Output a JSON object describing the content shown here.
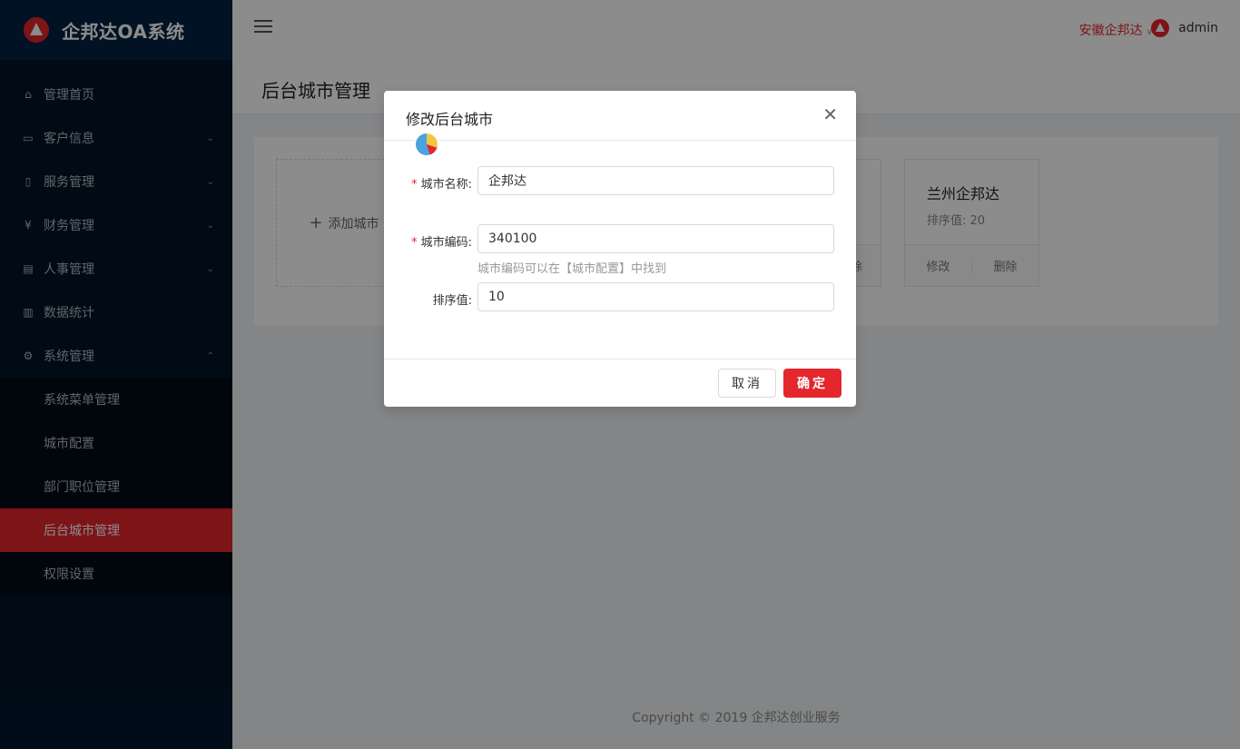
{
  "app": {
    "title": "企邦达OA系统"
  },
  "header": {
    "city": "安徽企邦达",
    "user": "admin"
  },
  "sidebar": {
    "items": [
      {
        "label": "管理首页",
        "icon": "home-icon"
      },
      {
        "label": "客户信息",
        "icon": "id-card-icon"
      },
      {
        "label": "服务管理",
        "icon": "file-icon"
      },
      {
        "label": "财务管理",
        "icon": "yen-icon"
      },
      {
        "label": "人事管理",
        "icon": "profile-icon"
      },
      {
        "label": "数据统计",
        "icon": "bar-chart-icon"
      },
      {
        "label": "系统管理",
        "icon": "gear-icon"
      }
    ],
    "sub_items": [
      {
        "label": "系统菜单管理"
      },
      {
        "label": "城市配置"
      },
      {
        "label": "部门职位管理"
      },
      {
        "label": "后台城市管理"
      },
      {
        "label": "权限设置"
      }
    ]
  },
  "page": {
    "title": "后台城市管理",
    "add_label": "添加城市",
    "cards": [
      {
        "name": "兰州企邦达",
        "order_label": "排序值:",
        "order": "20",
        "edit": "修改",
        "delete": "删除"
      }
    ],
    "hidden_card_delete_fragment": "除"
  },
  "footer": {
    "text": "Copyright © 2019 企邦达创业服务"
  },
  "modal": {
    "title": "修改后台城市",
    "fields": {
      "name_label": "城市名称:",
      "name_value": "企邦达",
      "code_label": "城市编码:",
      "code_value": "340100",
      "code_help": "城市编码可以在【城市配置】中找到",
      "order_label": "排序值:",
      "order_value": "10"
    },
    "cancel": "取消",
    "ok": "确定"
  }
}
